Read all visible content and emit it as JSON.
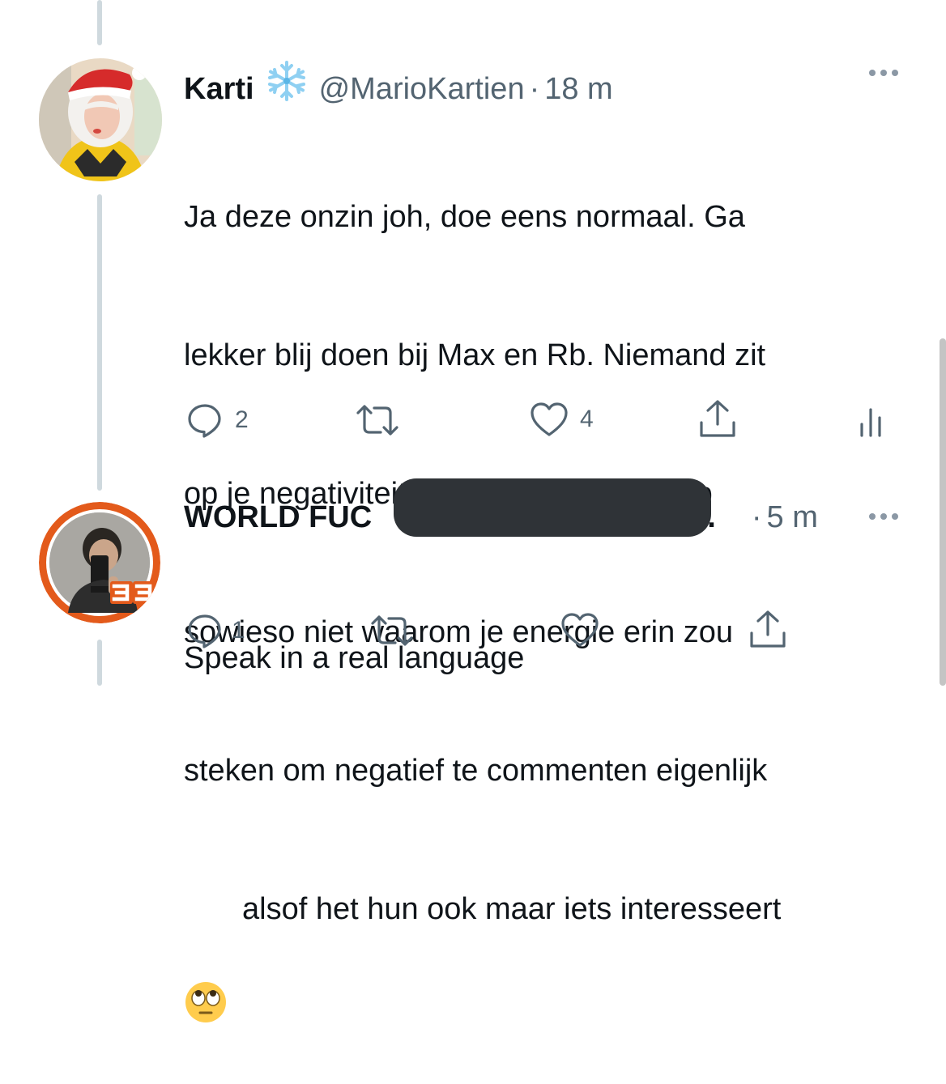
{
  "tweets": [
    {
      "display_name": "Karti",
      "badge_icon": "snowflake-icon",
      "handle": "@MarioKartien",
      "separator": "·",
      "time": "18 m",
      "text_lines": [
        "Ja deze onzin joh, doe eens normaal. Ga",
        "lekker blij doen bij Max en Rb. Niemand zit",
        "op je negativiteit hier te wachten. Snap",
        "sowieso niet waarom je energie erin zou",
        "steken om negatief te commenten eigenlijk",
        "alsof het hun ook maar iets interesseert"
      ],
      "emoji": "🙄",
      "reply_count": "2",
      "retweet_count": "",
      "like_count": "4"
    },
    {
      "display_name_visible": "WORLD FUC",
      "display_name_trailing": "...",
      "separator": "·",
      "time": "5 m",
      "text_lines": [
        "Speak in a real language"
      ],
      "reply_count": "1",
      "retweet_count": "",
      "like_count": ""
    }
  ],
  "colors": {
    "text": "#0f1419",
    "muted": "#536471",
    "thread_line": "#cfd9de",
    "redaction": "#2f3337",
    "avatar2_ring": "#e35a1b"
  }
}
